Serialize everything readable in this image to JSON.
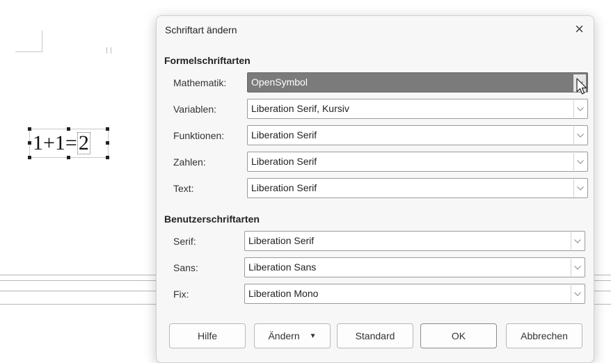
{
  "document": {
    "formula": {
      "parts": [
        "1+1=",
        "2"
      ]
    }
  },
  "dialog": {
    "title": "Schriftart ändern",
    "close_glyph": "×",
    "formula_section": {
      "heading": "Formelschriftarten",
      "rows": [
        {
          "label": "Mathematik:",
          "value": "OpenSymbol",
          "selected": true
        },
        {
          "label": "Variablen:",
          "value": "Liberation Serif, Kursiv"
        },
        {
          "label": "Funktionen:",
          "value": "Liberation Serif"
        },
        {
          "label": "Zahlen:",
          "value": "Liberation Serif"
        },
        {
          "label": "Text:",
          "value": "Liberation Serif"
        }
      ]
    },
    "user_section": {
      "heading": "Benutzerschriftarten",
      "rows": [
        {
          "label": "Serif:",
          "value": "Liberation Serif"
        },
        {
          "label": "Sans:",
          "value": "Liberation Sans"
        },
        {
          "label": "Fix:",
          "value": "Liberation Mono"
        }
      ]
    },
    "buttons": {
      "help": "Hilfe",
      "change": "Ändern",
      "change_dropdown_glyph": "▼",
      "default": "Standard",
      "ok": "OK",
      "cancel": "Abbrechen"
    }
  },
  "icons": {
    "dropdown": "chevron-down-icon",
    "close": "close-icon",
    "cursor": "mouse-pointer-icon"
  },
  "colors": {
    "selected_combo_bg": "#7b7b7b",
    "dialog_bg": "#f7f7f7"
  }
}
